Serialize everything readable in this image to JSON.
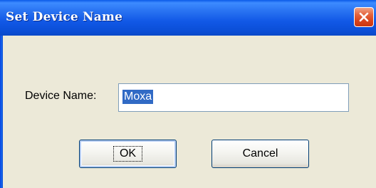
{
  "window": {
    "title": "Set Device Name",
    "close_icon": "close-x-icon"
  },
  "form": {
    "device_name_label": "Device Name:",
    "device_name_value": "Moxa"
  },
  "buttons": {
    "ok_label": "OK",
    "cancel_label": "Cancel"
  },
  "colors": {
    "titlebar": "#1158e6",
    "dialog_background": "#ece9d8",
    "selection_highlight": "#316ac5",
    "close_button": "#d8431c"
  }
}
